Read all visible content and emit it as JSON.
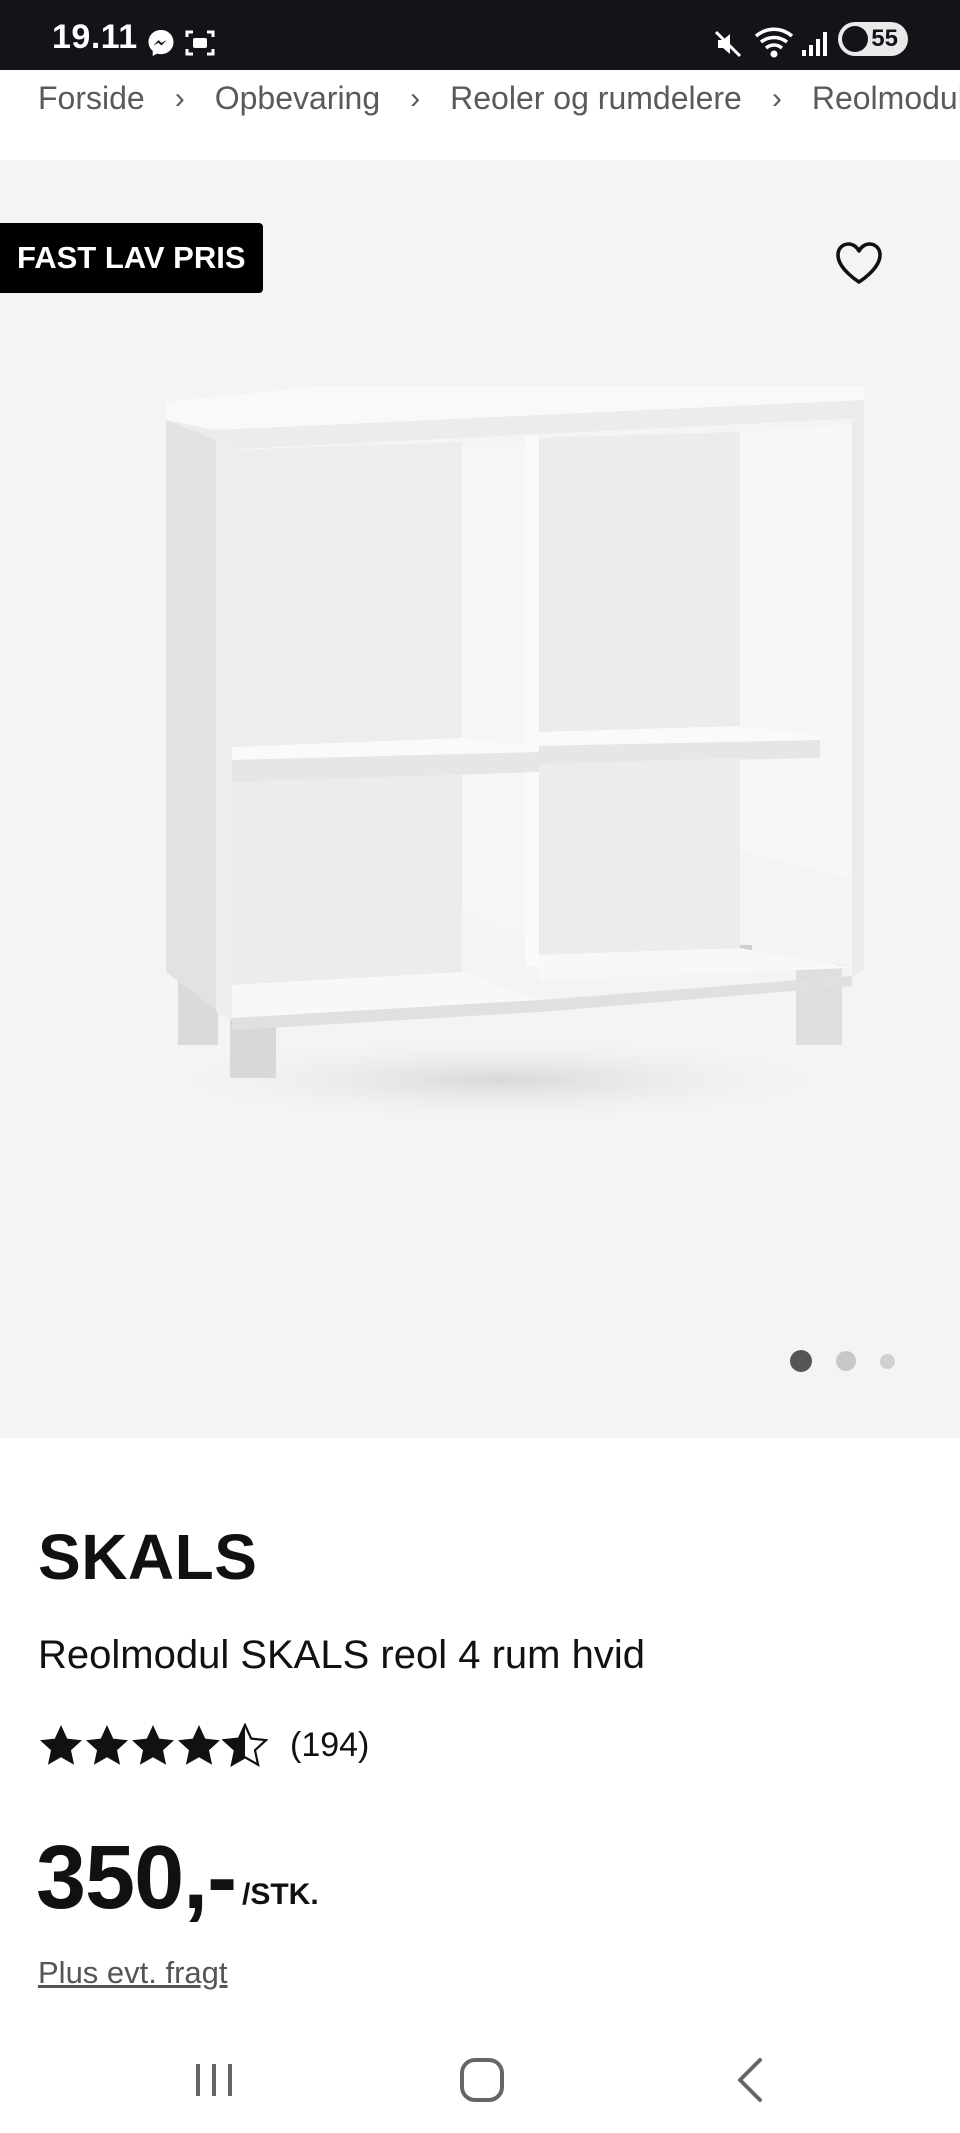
{
  "status_bar": {
    "time": "19.11",
    "battery": "55",
    "icons": [
      "messenger-icon",
      "screenshot-icon",
      "mute-icon",
      "wifi-icon",
      "signal-icon",
      "battery-icon"
    ]
  },
  "breadcrumb": {
    "items": [
      "Forside",
      "Opbevaring",
      "Reoler og rumdelere",
      "Reolmodul"
    ],
    "separator": "›"
  },
  "hero": {
    "badge": "FAST LAV PRIS",
    "favorite_icon": "heart-outline-icon",
    "carousel": {
      "total": 3,
      "active": 0
    }
  },
  "product": {
    "brand": "SKALS",
    "name": "Reolmodul SKALS reol 4 rum hvid",
    "rating": 4.5,
    "rating_count": "(194)",
    "price": "350,-",
    "price_unit": "/STK.",
    "shipping_link": "Plus evt. fragt"
  },
  "nav": {
    "recent_icon": "recent-apps-icon",
    "home_icon": "home-icon",
    "back_icon": "back-icon"
  },
  "colors": {
    "status_bg": "#13141a",
    "hero_bg": "#f4f4f4",
    "badge_bg": "#000000",
    "text": "#111111",
    "muted": "#5a5a5a"
  }
}
